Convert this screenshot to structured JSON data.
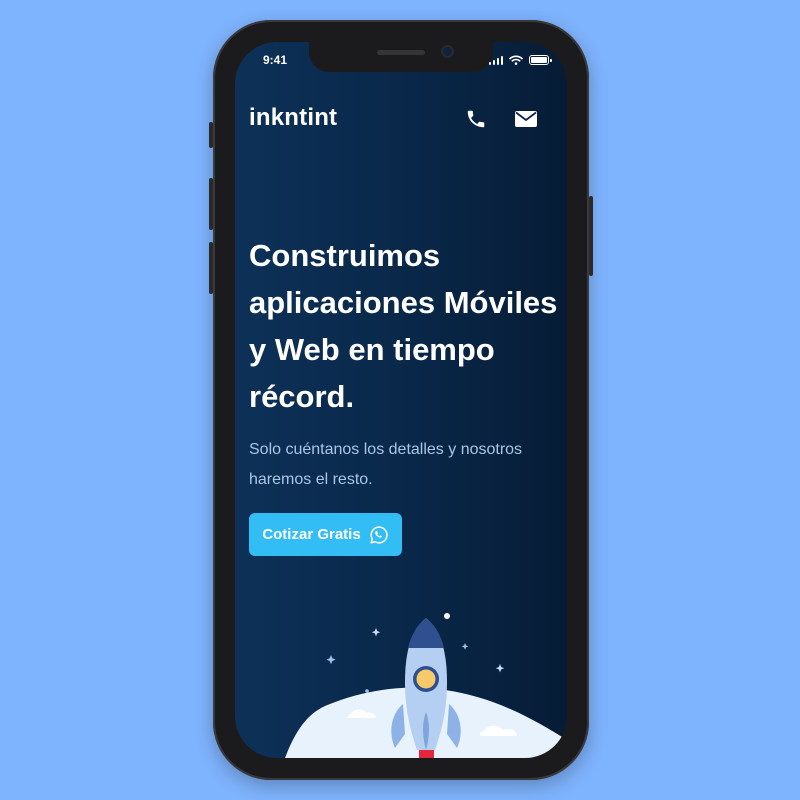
{
  "status_bar": {
    "time": "9:41"
  },
  "header": {
    "brand": "inkntint",
    "icons": [
      "phone-icon",
      "mail-icon"
    ]
  },
  "hero": {
    "headline": "Construimos aplicaciones Móviles y Web en tiempo récord.",
    "subtext": "Solo cuéntanos los detalles y nosotros haremos el resto.",
    "cta_label": "Cotizar Gratis",
    "cta_icon": "whatsapp-icon"
  },
  "colors": {
    "page_background": "#7eb3fd",
    "screen_background": "#092748",
    "accent": "#33bdf5",
    "subtext": "#a9c6e6"
  }
}
